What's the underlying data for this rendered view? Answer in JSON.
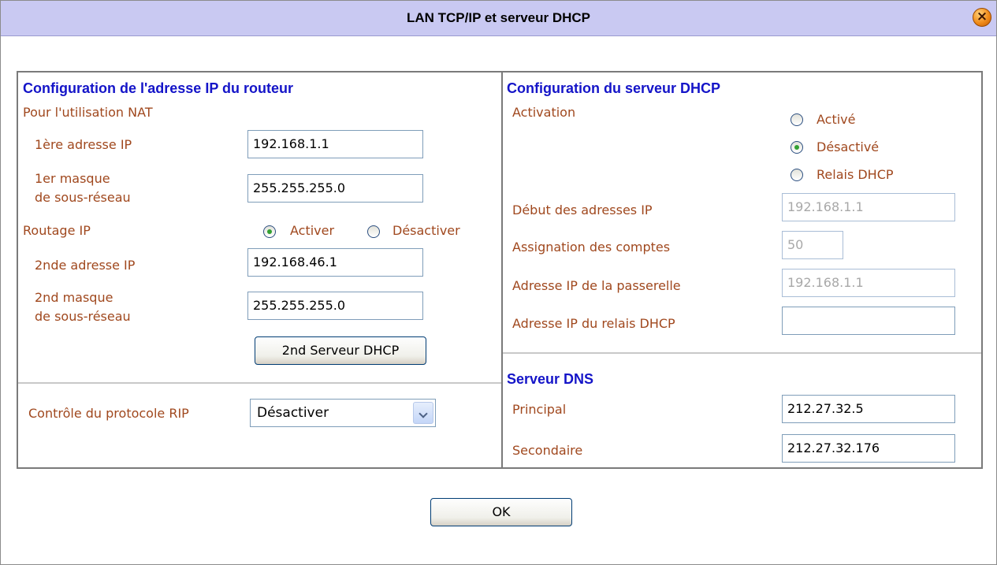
{
  "dialog": {
    "title": "LAN TCP/IP et serveur DHCP",
    "close_icon": "close-icon",
    "ok_label": "OK"
  },
  "router": {
    "section_title": "Configuration de l'adresse IP du routeur",
    "nat_label": "Pour l'utilisation NAT",
    "ip1_label": "1ère adresse IP",
    "ip1_value": "192.168.1.1",
    "mask1_label_line1": "1er masque",
    "mask1_label_line2": "de sous-réseau",
    "mask1_value": "255.255.255.0",
    "routing_label": "Routage IP",
    "routing_options": [
      "Activer",
      "Désactiver"
    ],
    "routing_selected": "Activer",
    "ip2_label": "2nde adresse IP",
    "ip2_value": "192.168.46.1",
    "mask2_label_line1": "2nd masque",
    "mask2_label_line2": "de sous-réseau",
    "mask2_value": "255.255.255.0",
    "dhcp2_button": "2nd Serveur DHCP",
    "rip_label": "Contrôle du protocole RIP",
    "rip_value": "Désactiver"
  },
  "dhcp": {
    "section_title": "Configuration du serveur DHCP",
    "activation_label": "Activation",
    "options": [
      "Activé",
      "Désactivé",
      "Relais DHCP"
    ],
    "selected": "Désactivé",
    "start_label": "Début des adresses IP",
    "start_value": "192.168.1.1",
    "count_label": "Assignation des comptes",
    "count_value": "50",
    "gateway_label": "Adresse IP de la passerelle",
    "gateway_value": "192.168.1.1",
    "relay_label": "Adresse IP du relais DHCP",
    "relay_value": ""
  },
  "dns": {
    "section_title": "Serveur DNS",
    "primary_label": "Principal",
    "primary_value": "212.27.32.5",
    "secondary_label": "Secondaire",
    "secondary_value": "212.27.32.176"
  },
  "colors": {
    "titlebar_bg": "#c9c9f2",
    "section_title": "#1414c8",
    "label": "#a0481e",
    "radio_dot": "#33a033"
  }
}
